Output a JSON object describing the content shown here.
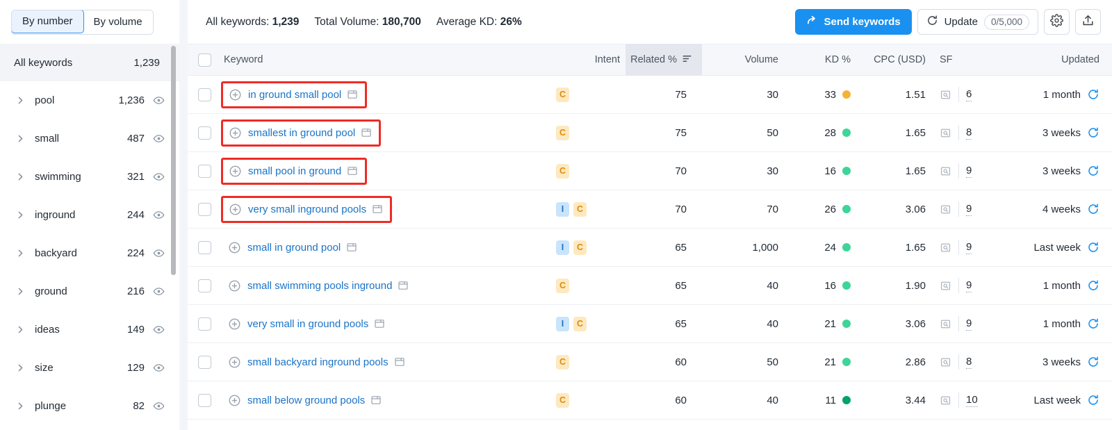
{
  "sidebar": {
    "toggle": {
      "by_number": "By number",
      "by_volume": "By volume",
      "active": "By number"
    },
    "all_keywords": {
      "label": "All keywords",
      "count": "1,239"
    },
    "items": [
      {
        "label": "pool",
        "count": "1,236"
      },
      {
        "label": "small",
        "count": "487"
      },
      {
        "label": "swimming",
        "count": "321"
      },
      {
        "label": "inground",
        "count": "244"
      },
      {
        "label": "backyard",
        "count": "224"
      },
      {
        "label": "ground",
        "count": "216"
      },
      {
        "label": "ideas",
        "count": "149"
      },
      {
        "label": "size",
        "count": "129"
      },
      {
        "label": "plunge",
        "count": "82"
      }
    ]
  },
  "topbar": {
    "stats": [
      {
        "label": "All keywords:",
        "value": "1,239"
      },
      {
        "label": "Total Volume:",
        "value": "180,700"
      },
      {
        "label": "Average KD:",
        "value": "26%"
      }
    ],
    "send_keywords": "Send keywords",
    "update": "Update",
    "update_quota": "0/5,000",
    "settings_icon": "gear-icon",
    "export_icon": "export-icon"
  },
  "table": {
    "columns": {
      "keyword": "Keyword",
      "intent": "Intent",
      "related": "Related %",
      "volume": "Volume",
      "kd": "KD %",
      "cpc": "CPC (USD)",
      "sf": "SF",
      "updated": "Updated"
    },
    "sorted_column": "Related %",
    "rows": [
      {
        "keyword": "in ground small pool",
        "highlighted": true,
        "intent": [
          "C"
        ],
        "related": "75",
        "volume": "30",
        "kd": "33",
        "kd_color": "#f5b335",
        "cpc": "1.51",
        "sf": "6",
        "updated": "1 month"
      },
      {
        "keyword": "smallest in ground pool",
        "highlighted": true,
        "intent": [
          "C"
        ],
        "related": "75",
        "volume": "50",
        "kd": "28",
        "kd_color": "#3dd598",
        "cpc": "1.65",
        "sf": "8",
        "updated": "3 weeks"
      },
      {
        "keyword": "small pool in ground",
        "highlighted": true,
        "intent": [
          "C"
        ],
        "related": "70",
        "volume": "30",
        "kd": "16",
        "kd_color": "#3dd598",
        "cpc": "1.65",
        "sf": "9",
        "updated": "3 weeks"
      },
      {
        "keyword": "very small inground pools",
        "highlighted": true,
        "intent": [
          "I",
          "C"
        ],
        "related": "70",
        "volume": "70",
        "kd": "26",
        "kd_color": "#3dd598",
        "cpc": "3.06",
        "sf": "9",
        "updated": "4 weeks"
      },
      {
        "keyword": "small in ground pool",
        "highlighted": false,
        "intent": [
          "I",
          "C"
        ],
        "related": "65",
        "volume": "1,000",
        "kd": "24",
        "kd_color": "#3dd598",
        "cpc": "1.65",
        "sf": "9",
        "updated": "Last week"
      },
      {
        "keyword": "small swimming pools inground",
        "highlighted": false,
        "intent": [
          "C"
        ],
        "related": "65",
        "volume": "40",
        "kd": "16",
        "kd_color": "#3dd598",
        "cpc": "1.90",
        "sf": "9",
        "updated": "1 month"
      },
      {
        "keyword": "very small in ground pools",
        "highlighted": false,
        "intent": [
          "I",
          "C"
        ],
        "related": "65",
        "volume": "40",
        "kd": "21",
        "kd_color": "#3dd598",
        "cpc": "3.06",
        "sf": "9",
        "updated": "1 month"
      },
      {
        "keyword": "small backyard inground pools",
        "highlighted": false,
        "intent": [
          "C"
        ],
        "related": "60",
        "volume": "50",
        "kd": "21",
        "kd_color": "#3dd598",
        "cpc": "2.86",
        "sf": "8",
        "updated": "3 weeks"
      },
      {
        "keyword": "small below ground pools",
        "highlighted": false,
        "intent": [
          "C"
        ],
        "related": "60",
        "volume": "40",
        "kd": "11",
        "kd_color": "#00a36c",
        "cpc": "3.44",
        "sf": "10",
        "updated": "Last week"
      }
    ]
  },
  "colors": {
    "accent": "#1a91f0",
    "link": "#1a73c7",
    "highlight_box": "#ef2b25",
    "intent_commercial_bg": "#fde9c0",
    "intent_informational_bg": "#c9e4fb"
  }
}
